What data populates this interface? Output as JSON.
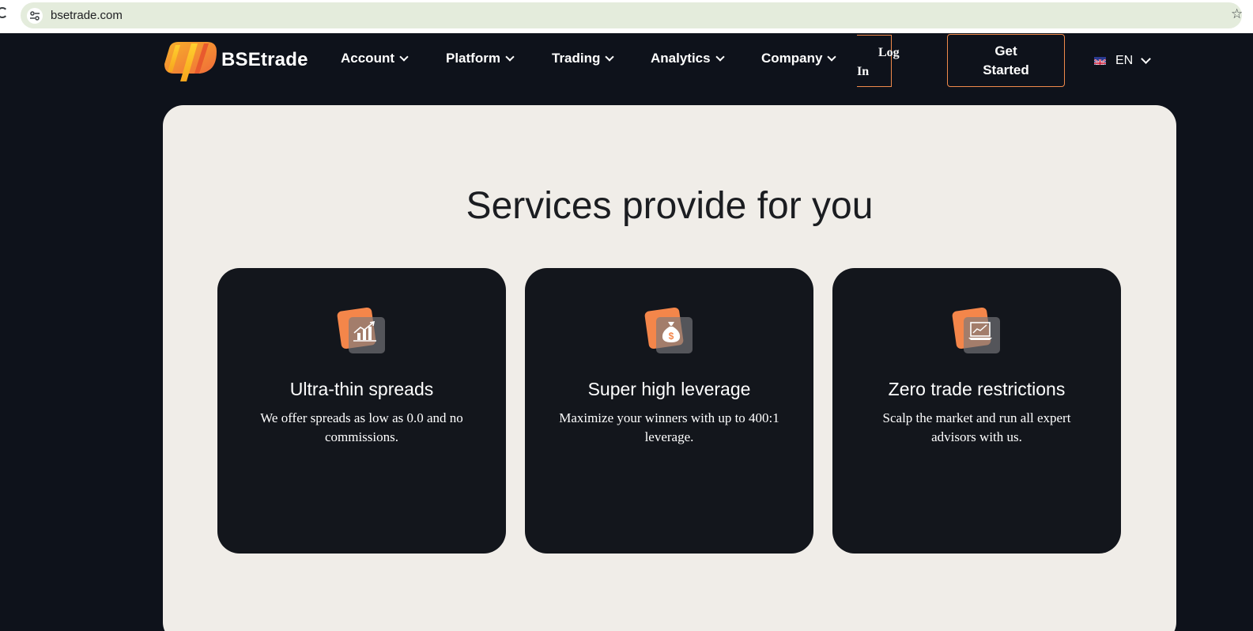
{
  "browser": {
    "url": "bsetrade.com"
  },
  "header": {
    "logo_text": "BSEtrade",
    "nav": [
      {
        "label": "Account"
      },
      {
        "label": "Platform"
      },
      {
        "label": "Trading"
      },
      {
        "label": "Analytics"
      },
      {
        "label": "Company"
      }
    ],
    "login_label": "Log In",
    "get_started_label": "Get Started",
    "language": "EN"
  },
  "services": {
    "title": "Services provide for you",
    "cards": [
      {
        "title": "Ultra-thin spreads",
        "description": "We offer spreads as low as 0.0 and no commissions.",
        "icon": "chart-growth-icon"
      },
      {
        "title": "Super high leverage",
        "description": "Maximize your winners with up to 400:1 leverage.",
        "icon": "money-bag-icon"
      },
      {
        "title": "Zero trade restrictions",
        "description": "Scalp the market and run all expert advisors with us.",
        "icon": "laptop-chart-icon"
      }
    ]
  },
  "colors": {
    "accent": "#f4864a",
    "page_bg": "#0e121b",
    "panel_bg": "#f0ede8",
    "card_bg": "#13161c"
  }
}
